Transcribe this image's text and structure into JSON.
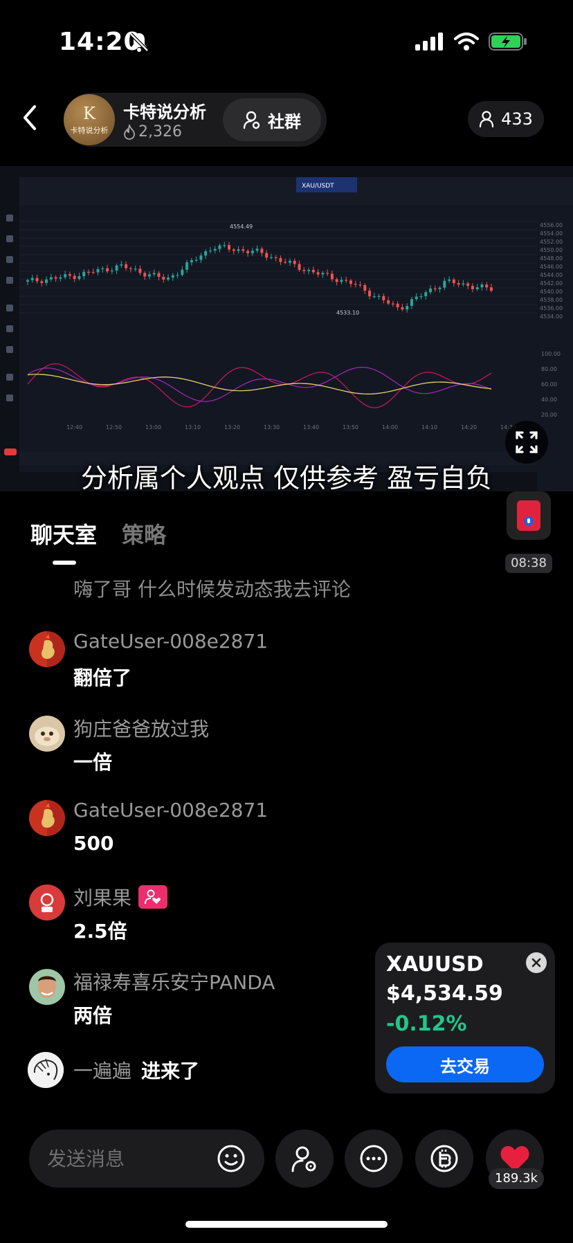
{
  "status_bar": {
    "time": "14:20",
    "battery": "charging"
  },
  "header": {
    "streamer_name": "卡特说分析",
    "streamer_likes": "2,326",
    "avatar_monogram": "K",
    "avatar_caption": "卡特说分析",
    "community_label": "社群",
    "viewer_count": "433"
  },
  "stream": {
    "subtitle": "分析属个人观点 仅供参考 盈亏自负",
    "chart_symbol": "XAU/USDT",
    "high_label": "4554.49",
    "low_label": "4533.10",
    "price_ticks": [
      "4556.00",
      "4554.00",
      "4552.00",
      "4550.00",
      "4548.00",
      "4546.00",
      "4544.00",
      "4542.00",
      "4540.00",
      "4538.00",
      "4536.00",
      "4534.00"
    ],
    "osc_ticks": [
      "100.00",
      "80.00",
      "60.00",
      "40.00",
      "20.00"
    ],
    "time_ticks": [
      "12:40",
      "12:50",
      "13:00",
      "13:10",
      "13:20",
      "13:30",
      "13:40",
      "13:50",
      "14:00",
      "14:10",
      "14:20",
      "14:30"
    ]
  },
  "tabs": {
    "chat": "聊天室",
    "strategy": "策略",
    "active": "chat"
  },
  "live_thumb": {
    "time": "08:38"
  },
  "chat": {
    "prev_message": "嗨了哥 什么时候发动态我去评论",
    "messages": [
      {
        "user": "GateUser-008e2871",
        "text": "翻倍了"
      },
      {
        "user": "狗庄爸爸放过我",
        "text": "一倍"
      },
      {
        "user": "GateUser-008e2871",
        "text": "500"
      },
      {
        "user": "刘果果",
        "text": "2.5倍",
        "badge": "heart-badge"
      },
      {
        "user": "福禄寿喜乐安宁PANDA",
        "text": "两倍"
      }
    ],
    "join": {
      "user": "一遍遍",
      "text": "进来了"
    }
  },
  "ticker": {
    "symbol": "XAUUSD",
    "price": "$4,534.59",
    "change": "-0.12%",
    "trade_label": "去交易",
    "change_color": "#1fc78b"
  },
  "bottom_bar": {
    "input_placeholder": "发送消息",
    "like_count": "189.3k"
  },
  "colors": {
    "accent_blue": "#0a68f4",
    "heart_red": "#e8203f",
    "up_green": "#26a69a",
    "down_red": "#ef5350"
  },
  "chart_data": {
    "type": "line",
    "title": "",
    "xlabel": "",
    "ylabel": "",
    "x": [
      "12:40",
      "12:50",
      "13:00",
      "13:10",
      "13:20",
      "13:30",
      "13:40",
      "13:50",
      "14:00",
      "14:10",
      "14:20"
    ],
    "series": [
      {
        "values": [
          4541.5,
          4543.0,
          4545.5,
          4542.0,
          4550.5,
          4549.0,
          4544.5,
          4541.0,
          4534.5,
          4541.5,
          4539.5
        ]
      }
    ],
    "ylim": [
      4532,
      4557
    ],
    "grid": true
  }
}
